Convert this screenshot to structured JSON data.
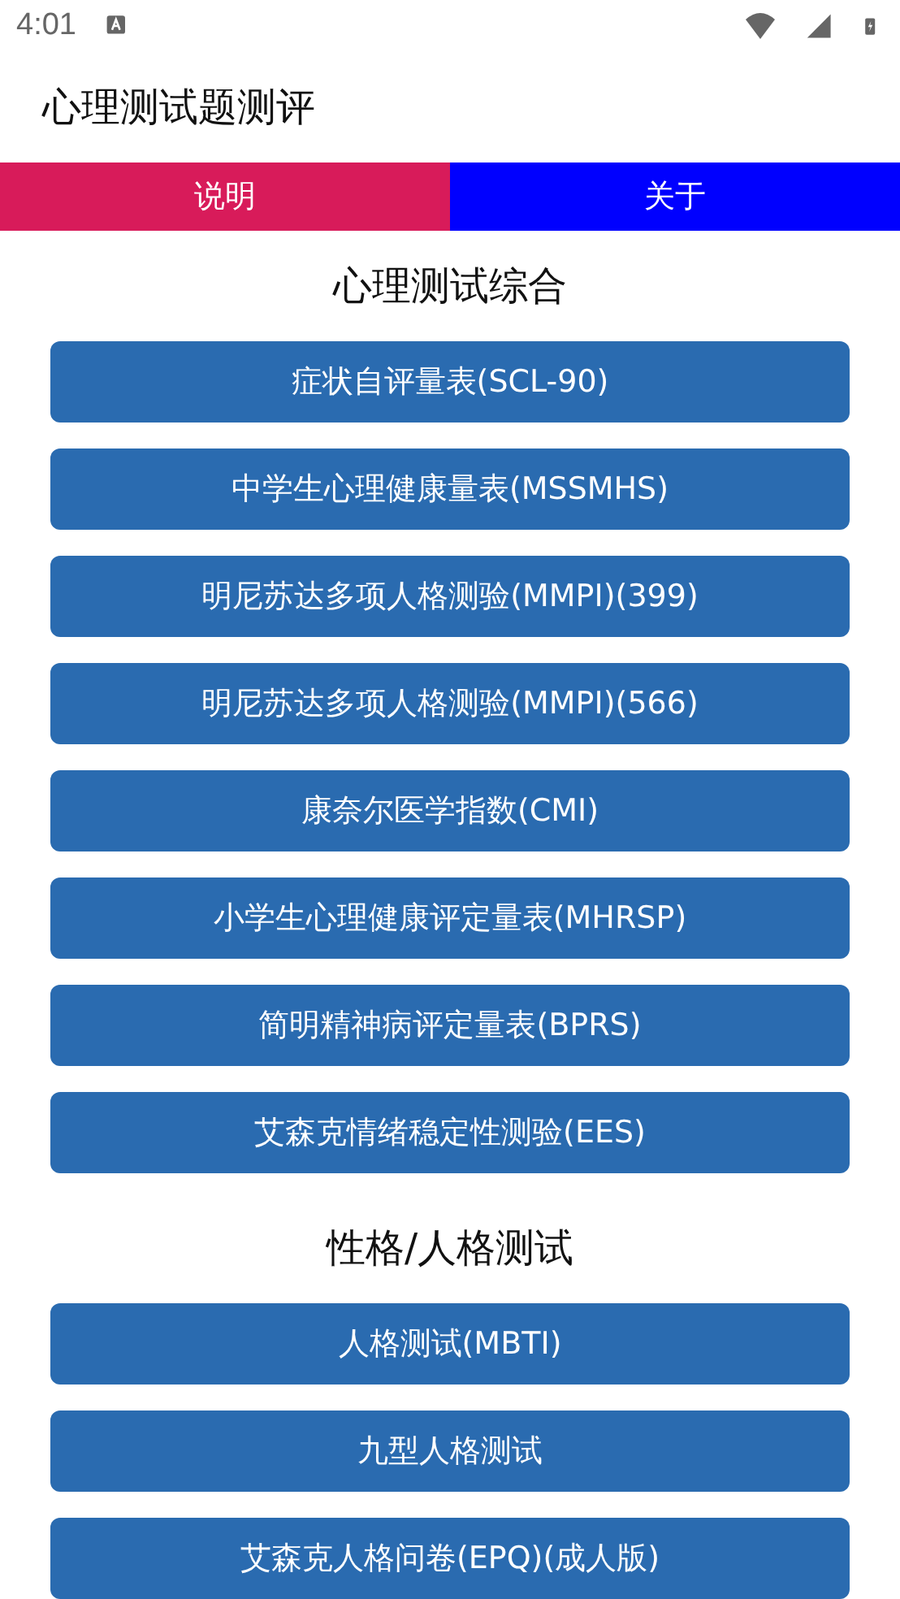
{
  "status_bar": {
    "time": "4:01"
  },
  "app_bar": {
    "title": "心理测试题测评"
  },
  "tabs": [
    {
      "label": "说明",
      "color": "#d81b5a"
    },
    {
      "label": "关于",
      "color": "#0000ff"
    }
  ],
  "sections": [
    {
      "title": "心理测试综合",
      "tests": [
        "症状自评量表(SCL-90)",
        "中学生心理健康量表(MSSMHS)",
        "明尼苏达多项人格测验(MMPI)(399)",
        "明尼苏达多项人格测验(MMPI)(566)",
        "康奈尔医学指数(CMI)",
        "小学生心理健康评定量表(MHRSP)",
        "简明精神病评定量表(BPRS)",
        "艾森克情绪稳定性测验(EES)"
      ]
    },
    {
      "title": "性格/人格测试",
      "tests": [
        "人格测试(MBTI)",
        "九型人格测试",
        "艾森克人格问卷(EPQ)(成人版)"
      ]
    }
  ]
}
